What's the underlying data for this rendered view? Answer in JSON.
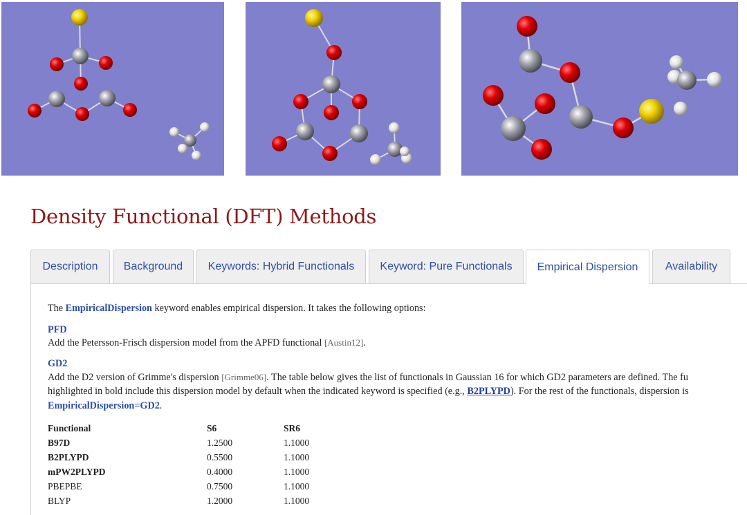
{
  "page_title": "Density Functional (DFT) Methods",
  "tabs": [
    {
      "label": "Description"
    },
    {
      "label": "Background"
    },
    {
      "label": "Keywords: Hybrid Functionals"
    },
    {
      "label": "Keyword: Pure Functionals"
    },
    {
      "label": "Empirical Dispersion"
    },
    {
      "label": "Availability"
    }
  ],
  "active_tab": "Empirical Dispersion",
  "intro": {
    "before": "The ",
    "keyword": "EmpiricalDispersion",
    "after": " keyword enables empirical dispersion. It takes the following options:"
  },
  "options": [
    {
      "name": "PFD",
      "text_before": "Add the Petersson-Frisch dispersion model from the APFD functional ",
      "citation": "[Austin12]",
      "text_after": "."
    },
    {
      "name": "GD2",
      "line1_before": "Add the D2 version of Grimme's dispersion ",
      "line1_citation": "[Grimme06]",
      "line1_after": ". The table below gives the list of functionals in Gaussian 16 for which GD2 parameters are defined. The fu",
      "line2_before": "highlighted in bold include this dispersion model by default when the indicated keyword is specified (e.g., ",
      "line2_link": "B2PLYPD",
      "line2_after": "). For the rest of the functionals, dispersion is",
      "line3_keyword": "EmpiricalDispersion=GD2",
      "line3_after": "."
    }
  ],
  "table": {
    "headers": [
      "Functional",
      "S6",
      "SR6"
    ],
    "rows": [
      {
        "functional": "B97D",
        "s6": "1.2500",
        "sr6": "1.1000",
        "bold": true
      },
      {
        "functional": "B2PLYPD",
        "s6": "0.5500",
        "sr6": "1.1000",
        "bold": true
      },
      {
        "functional": "mPW2PLYPD",
        "s6": "0.4000",
        "sr6": "1.1000",
        "bold": true
      },
      {
        "functional": "PBEPBE",
        "s6": "0.7500",
        "sr6": "1.1000",
        "bold": false
      },
      {
        "functional": "BLYP",
        "s6": "1.2000",
        "sr6": "1.1000",
        "bold": false
      }
    ]
  },
  "colors": {
    "title": "#8b1a1a",
    "tab_text": "#2e4fa8",
    "molecule_background": "#8080cc",
    "oxygen_atom": "#d40000",
    "carbon_atom": "#9a9aa2",
    "sulfur_atom": "#f0d000",
    "hydrogen_atom": "#e8e8e8"
  },
  "images": [
    {
      "name": "molecule-structure-1"
    },
    {
      "name": "molecule-structure-2"
    },
    {
      "name": "molecule-structure-3"
    }
  ]
}
